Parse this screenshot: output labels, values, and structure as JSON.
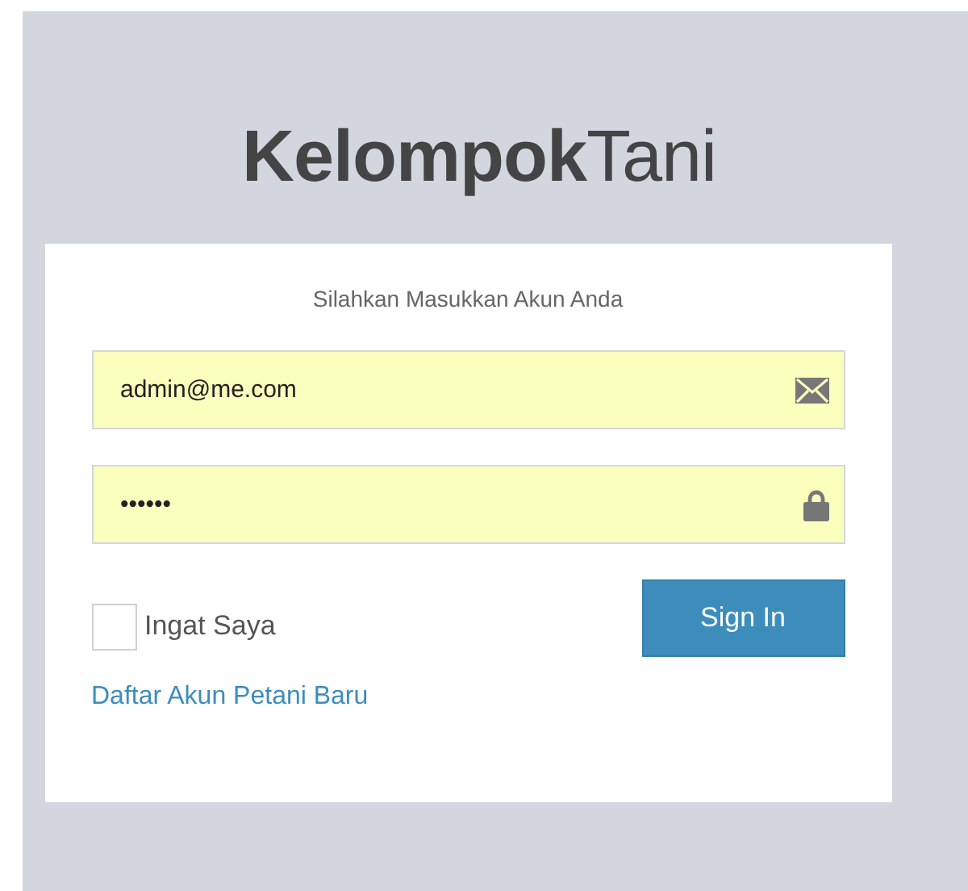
{
  "logo": "**Kelompok**Tani",
  "card": {
    "subtitle": "Silahkan Masukkan Akun Anda",
    "fields": [
      {
        "kind": "email",
        "value": "admin@me.com"
      },
      {
        "kind": "password",
        "value": "••••••"
      }
    ],
    "remember": {
      "label": "Ingat Saya",
      "checked": false
    },
    "button": "Sign In",
    "link": "Daftar Akun Petani Baru"
  }
}
